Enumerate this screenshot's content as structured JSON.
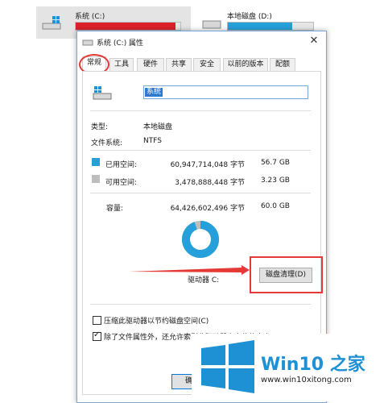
{
  "background": {
    "drive_c": {
      "name": "系统 (C:)",
      "used_fraction": 0.95,
      "bar_color": "#da2127"
    },
    "drive_d": {
      "name": "本地磁盘 (D:)",
      "used_fraction": 0.75,
      "bar_color": "#26a0da"
    }
  },
  "dialog": {
    "title": "系统 (C:) 属性",
    "tabs": [
      "常规",
      "工具",
      "硬件",
      "共享",
      "安全",
      "以前的版本",
      "配额"
    ],
    "active_tab": "常规",
    "name_value": "系统",
    "type_label": "类型:",
    "type_value": "本地磁盘",
    "fs_label": "文件系统:",
    "fs_value": "NTFS",
    "used_label": "已用空间:",
    "used_bytes": "60,947,714,048 字节",
    "used_size": "56.7 GB",
    "free_label": "可用空间:",
    "free_bytes": "3,478,888,448 字节",
    "free_size": "3.23 GB",
    "capacity_label": "容量:",
    "capacity_bytes": "64,426,602,496 字节",
    "capacity_size": "60.0 GB",
    "drive_label": "驱动器 C:",
    "cleanup_button": "磁盘清理(D)",
    "compress_label": "压缩此驱动器以节约磁盘空间(C)",
    "compress_checked": false,
    "index_label": "除了文件属性外，还允许索引此驱动器上文件的内容(I)",
    "index_checked": true,
    "ok_button": "确定",
    "used_color": "#26a0da",
    "free_color": "#bebebe",
    "used_fraction": 0.946
  },
  "watermark": {
    "brand": "Win10 之家",
    "url": "www.win10xitong.com",
    "logo_color": "#1e90d4"
  }
}
